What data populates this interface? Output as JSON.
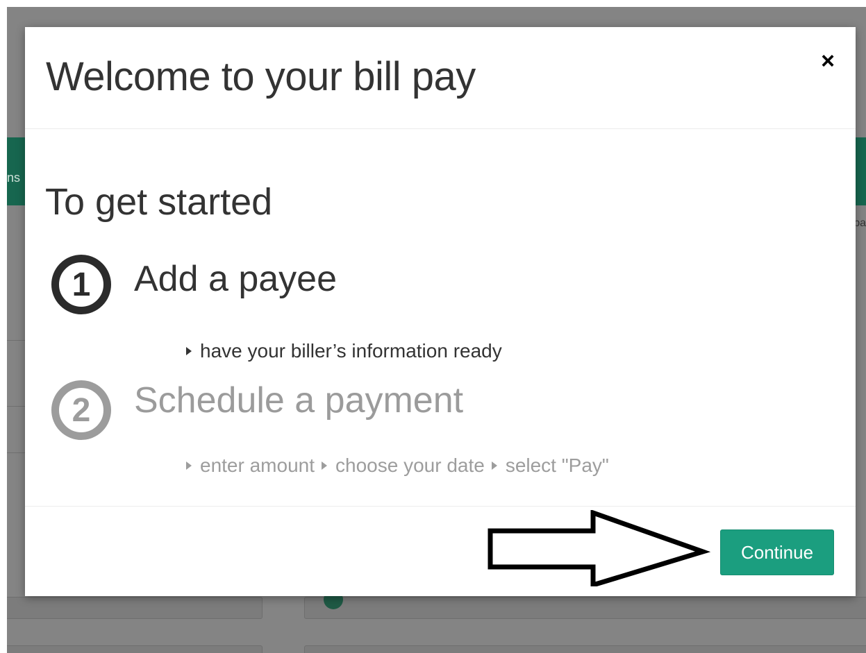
{
  "background": {
    "left_fragment": "ns",
    "right_fragment": "pa"
  },
  "modal": {
    "title": "Welcome to your bill pay",
    "close_glyph": "×",
    "subtitle": "To get started",
    "steps": [
      {
        "number": "1",
        "title": "Add a payee",
        "state": "active",
        "hints": [
          "have your biller’s information ready"
        ]
      },
      {
        "number": "2",
        "title": "Schedule a payment",
        "state": "inactive",
        "hints": [
          "enter amount",
          "choose your date",
          "select \"Pay\""
        ]
      }
    ],
    "continue_label": "Continue"
  },
  "colors": {
    "accent": "#1b9e7f",
    "bg_green": "#17664f",
    "active_text": "#333333",
    "inactive_text": "#9b9b9b"
  }
}
